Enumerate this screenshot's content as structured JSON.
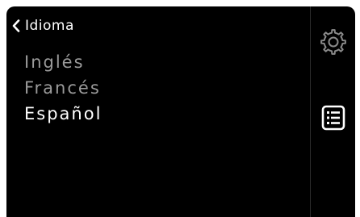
{
  "header": {
    "back_label": "Idioma"
  },
  "languages": {
    "items": [
      {
        "label": "Inglés",
        "selected": false
      },
      {
        "label": "Francés",
        "selected": false
      },
      {
        "label": "Español",
        "selected": true
      }
    ]
  },
  "side_panel": {
    "settings_icon": "gear-icon",
    "list_icon": "list-icon"
  },
  "colors": {
    "background": "#000000",
    "text_active": "#ffffff",
    "text_inactive": "#9a9a9a",
    "icon_gear": "#8a8a8a",
    "icon_list": "#ffffff",
    "divider": "#2c2c2c"
  }
}
